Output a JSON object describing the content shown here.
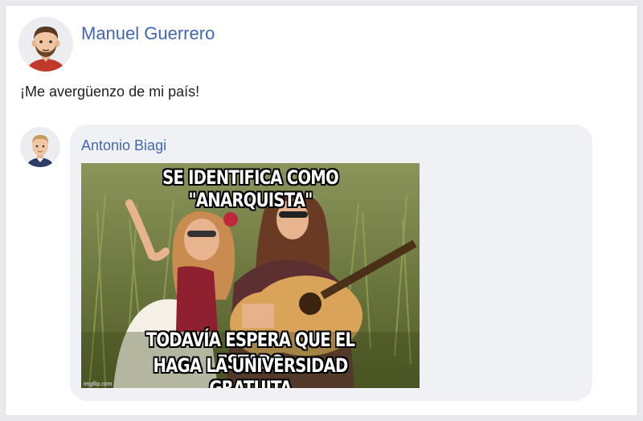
{
  "post": {
    "author": "Manuel Guerrero",
    "text": "¡Me avergüenzo de mi país!"
  },
  "comment": {
    "author": "Antonio Biagi",
    "meme": {
      "top_text": "SE IDENTIFICA COMO \"ANARQUISTA\"",
      "bottom_text_line1": "TODAVÍA ESPERA QUE EL ESTADO",
      "bottom_text_line2": "HAGA LA UNIVERSIDAD GRATUITA",
      "watermark": "imgflip.com"
    }
  },
  "colors": {
    "link_blue": "#4267b2",
    "bubble_bg": "#f0f1f4",
    "text": "#1c1e21"
  }
}
